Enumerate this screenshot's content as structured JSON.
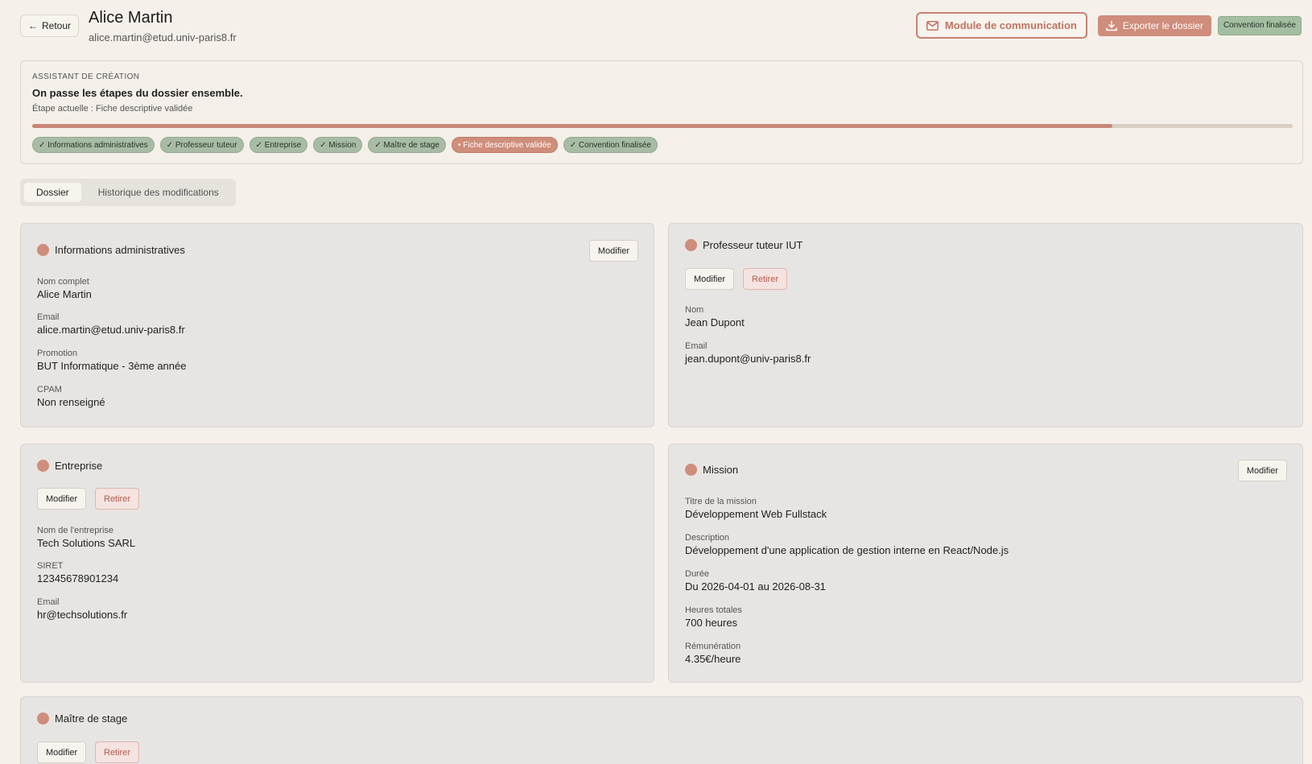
{
  "header": {
    "back_label": "Retour",
    "student_name": "Alice Martin",
    "student_email": "alice.martin@etud.univ-paris8.fr",
    "comm_label": "Module de communication",
    "export_label": "Exporter le dossier",
    "status_badge": "Convention finalisée"
  },
  "wizard": {
    "kicker": "ASSISTANT DE CRÉATION",
    "title": "On passe les étapes du dossier ensemble.",
    "current": "Étape actuelle : Fiche descriptive validée",
    "progress": 0.857,
    "steps": [
      {
        "label": "✓ Informations administratives",
        "active": false
      },
      {
        "label": "✓ Professeur tuteur",
        "active": false
      },
      {
        "label": "✓ Entreprise",
        "active": false
      },
      {
        "label": "✓ Mission",
        "active": false
      },
      {
        "label": "✓ Maître de stage",
        "active": false
      },
      {
        "label": "• Fiche descriptive validée",
        "active": true
      },
      {
        "label": "✓ Convention finalisée",
        "active": false
      }
    ]
  },
  "tabs": {
    "dossier": "Dossier",
    "history": "Historique des modifications"
  },
  "actions": {
    "modify": "Modifier",
    "remove": "Retirer"
  },
  "admin": {
    "title": "Informations administratives",
    "fields": [
      {
        "label": "Nom complet",
        "value": "Alice Martin"
      },
      {
        "label": "Email",
        "value": "alice.martin@etud.univ-paris8.fr"
      },
      {
        "label": "Promotion",
        "value": "BUT Informatique - 3ème année"
      },
      {
        "label": "CPAM",
        "value": "Non renseigné"
      }
    ]
  },
  "tutor": {
    "title": "Professeur tuteur IUT",
    "fields": [
      {
        "label": "Nom",
        "value": "Jean Dupont"
      },
      {
        "label": "Email",
        "value": "jean.dupont@univ-paris8.fr"
      }
    ]
  },
  "company": {
    "title": "Entreprise",
    "fields": [
      {
        "label": "Nom de l'entreprise",
        "value": "Tech Solutions SARL"
      },
      {
        "label": "SIRET",
        "value": "12345678901234"
      },
      {
        "label": "Email",
        "value": "hr@techsolutions.fr"
      }
    ]
  },
  "mission": {
    "title": "Mission",
    "fields": [
      {
        "label": "Titre de la mission",
        "value": "Développement Web Fullstack"
      },
      {
        "label": "Description",
        "value": "Développement d'une application de gestion interne en React/Node.js"
      },
      {
        "label": "Durée",
        "value": "Du 2026-04-01 au 2026-08-31"
      },
      {
        "label": "Heures totales",
        "value": "700 heures"
      },
      {
        "label": "Rémunération",
        "value": "4.35€/heure"
      }
    ]
  },
  "supervisor": {
    "title": "Maître de stage"
  }
}
